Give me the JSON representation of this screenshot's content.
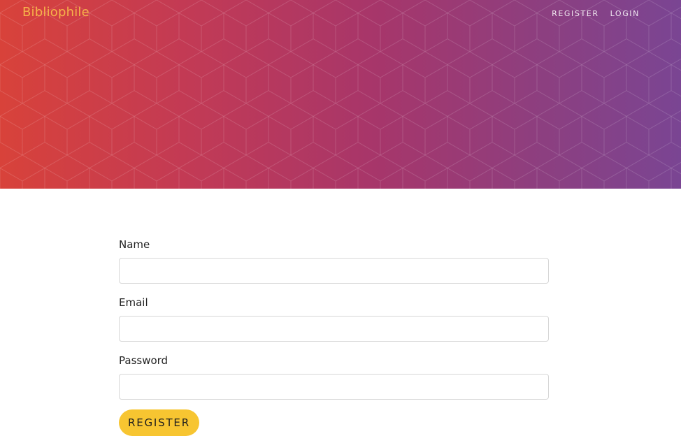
{
  "header": {
    "brand": "Bibliophile",
    "nav": [
      {
        "label": "REGISTER"
      },
      {
        "label": "LOGIN"
      }
    ]
  },
  "form": {
    "fields": [
      {
        "label": "Name",
        "value": ""
      },
      {
        "label": "Email",
        "value": ""
      },
      {
        "label": "Password",
        "value": ""
      }
    ],
    "submit_label": "REGISTER"
  },
  "colors": {
    "hero_gradient": [
      "#d8423a",
      "#c23a55",
      "#a7366a",
      "#8c3f80",
      "#7a4593"
    ],
    "brand": "#f6b24a",
    "button": "#f7c531"
  }
}
